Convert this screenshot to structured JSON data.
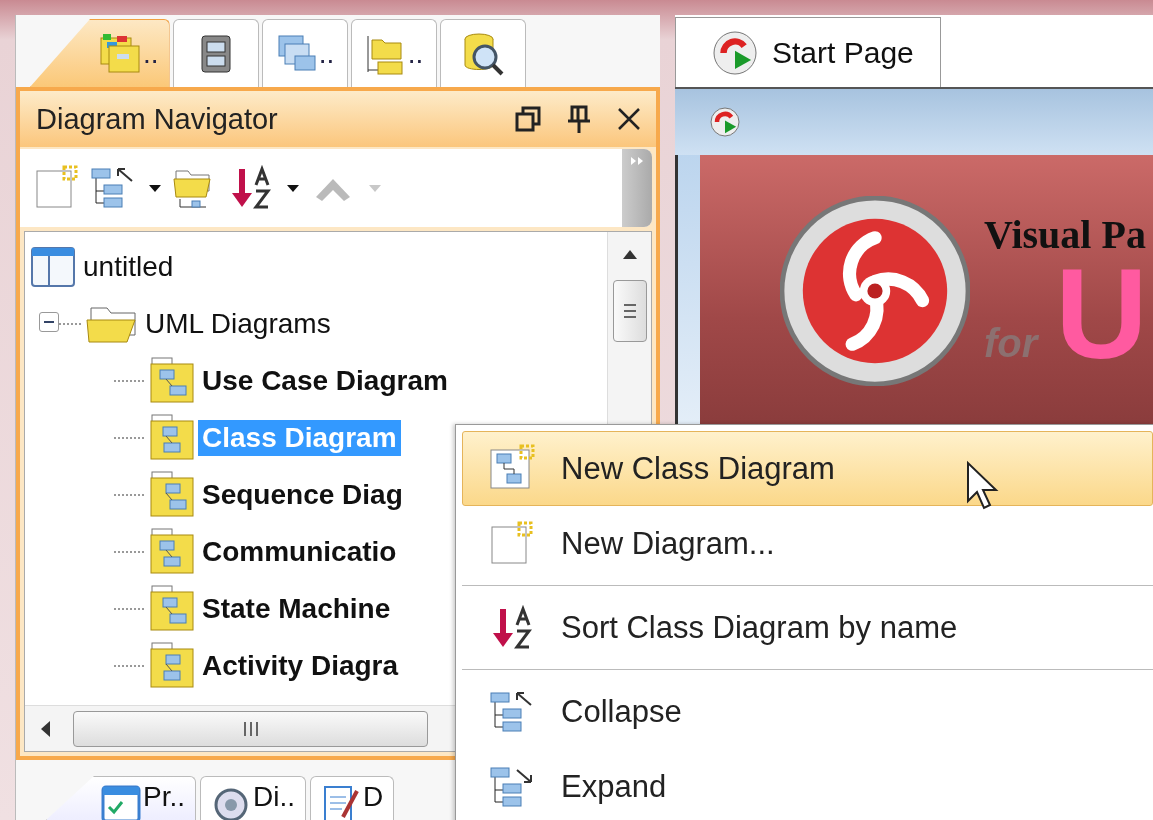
{
  "left_tabs": [
    {
      "label": "..",
      "selected": true
    },
    {
      "selected": false
    },
    {
      "label": "..",
      "selected": false
    },
    {
      "label": "..",
      "selected": false
    },
    {
      "selected": false
    }
  ],
  "navigator": {
    "title": "Diagram Navigator",
    "toolbar": [
      {
        "dropdown": false,
        "disabled": false
      },
      {
        "dropdown": true,
        "disabled": false
      },
      {
        "dropdown": false,
        "disabled": false
      },
      {
        "dropdown": true,
        "disabled": false
      },
      {
        "dropdown": true,
        "disabled": true
      }
    ],
    "tree": [
      {
        "label": "untitled",
        "kind": "project",
        "selected": false,
        "children": [
          {
            "label": "UML Diagrams",
            "kind": "folder",
            "expanded": true,
            "selected": false,
            "children": [
              {
                "label": "Use Case Diagram",
                "kind": "diagram",
                "selected": false
              },
              {
                "label": "Class Diagram",
                "kind": "diagram",
                "selected": true
              },
              {
                "label": "Sequence Diag",
                "kind": "diagram",
                "selected": false
              },
              {
                "label": "Communicatio",
                "kind": "diagram",
                "selected": false
              },
              {
                "label": "State Machine",
                "kind": "diagram",
                "selected": false
              },
              {
                "label": "Activity Diagra",
                "kind": "diagram",
                "selected": false
              }
            ]
          }
        ]
      }
    ]
  },
  "bottom_tabs": [
    {
      "label": "Pr..",
      "selected": true
    },
    {
      "label": "Di..",
      "selected": false
    },
    {
      "label": "D",
      "selected": false
    }
  ],
  "editor": {
    "tabs": [
      {
        "label": "Start Page",
        "selected": true
      }
    ],
    "banner": {
      "title": "Visual Pa",
      "subtitle": "for",
      "product": "U"
    }
  },
  "context_menu": {
    "items": [
      {
        "kind": "item",
        "label": "New Class Diagram",
        "selected": true
      },
      {
        "kind": "item",
        "label": "New Diagram...",
        "selected": false
      },
      {
        "kind": "separator"
      },
      {
        "kind": "item",
        "label": "Sort Class Diagram by name",
        "selected": false
      },
      {
        "kind": "separator"
      },
      {
        "kind": "item",
        "label": "Collapse",
        "selected": false
      },
      {
        "kind": "item",
        "label": "Expand",
        "selected": false
      }
    ]
  }
}
